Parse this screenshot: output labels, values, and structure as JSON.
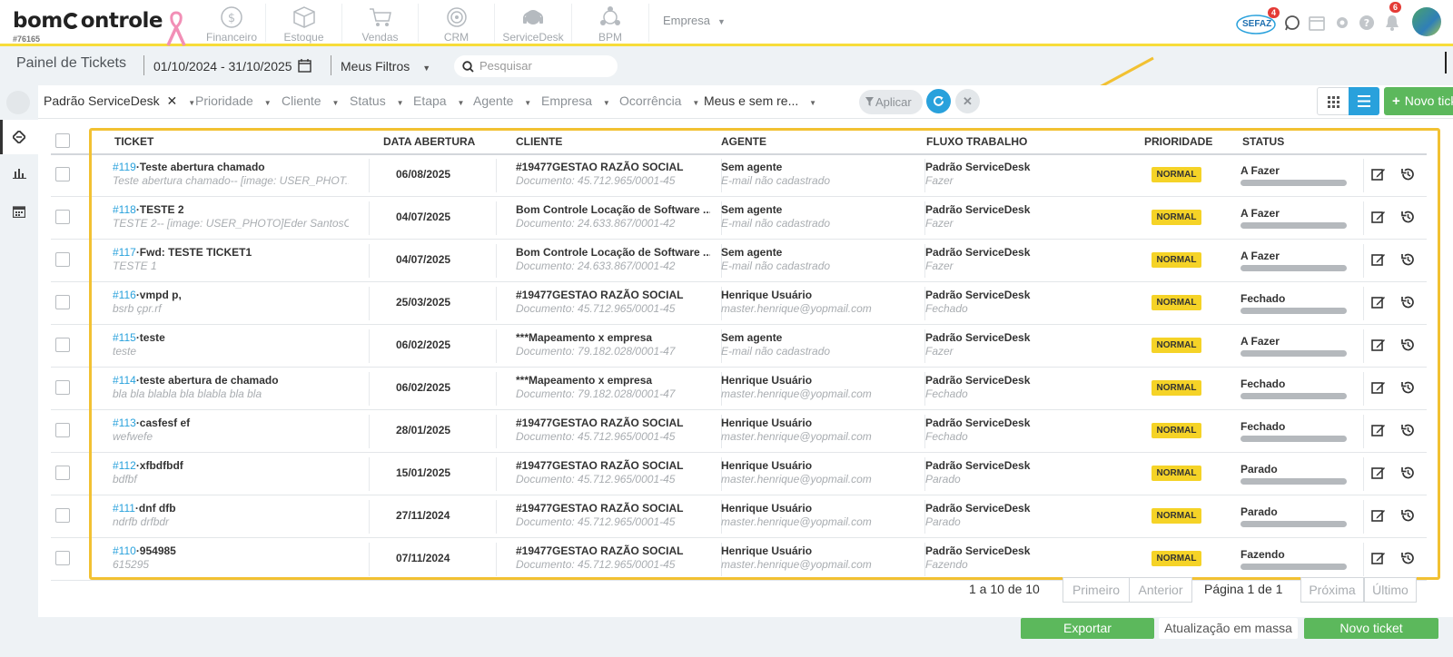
{
  "app": {
    "logo_text": "bomControle",
    "logo_left": "bom",
    "logo_right": "ontrole",
    "account_id": "#76165"
  },
  "modules": [
    {
      "label": "Financeiro",
      "icon": "dollar-coin-icon"
    },
    {
      "label": "Estoque",
      "icon": "box-icon"
    },
    {
      "label": "Vendas",
      "icon": "cart-icon"
    },
    {
      "label": "CRM",
      "icon": "target-icon"
    },
    {
      "label": "ServiceDesk",
      "icon": "headset-icon"
    },
    {
      "label": "BPM",
      "icon": "network-icon"
    }
  ],
  "company_menu": {
    "label": "Empresa"
  },
  "topright": {
    "sefaz_label": "SEFAZ",
    "sefaz_badge": "4",
    "notifications_badge": "6"
  },
  "toolbar": {
    "page_title": "Painel de Tickets",
    "date_range": "01/10/2024 - 31/10/2025",
    "my_filters": "Meus Filtros",
    "search_placeholder": "Pesquisar"
  },
  "filters": {
    "items": [
      "Padrão ServiceDesk",
      "Prioridade",
      "Cliente",
      "Status",
      "Etapa",
      "Agente",
      "Empresa",
      "Ocorrência",
      "Meus e sem re..."
    ],
    "apply_label": "Aplicar",
    "new_ticket_label": "Novo ticket"
  },
  "table": {
    "headers": [
      "TICKET",
      "DATA ABERTURA",
      "CLIENTE",
      "AGENTE",
      "FLUXO TRABALHO",
      "PRIORIDADE",
      "STATUS"
    ],
    "rows": [
      {
        "id": "#119",
        "title": "·Teste abertura chamado",
        "subtitle": "Teste abertura chamado-- [image: USER_PHOT...",
        "date": "06/08/2025",
        "client": "#19477GESTAO RAZÃO SOCIAL",
        "client_doc": "Documento: 45.712.965/0001-45",
        "agent": "Sem agente",
        "agent_email": "E-mail não cadastrado",
        "flow": "Padrão ServiceDesk",
        "flow_stage": "Fazer",
        "priority": "NORMAL",
        "status": "A Fazer",
        "progress": 0
      },
      {
        "id": "#118",
        "title": "·TESTE 2",
        "subtitle": "TESTE 2-- [image: USER_PHOTO]Eder SantosCo...",
        "date": "04/07/2025",
        "client": "Bom Controle Locação de Software ...",
        "client_doc": "Documento: 24.633.867/0001-42",
        "agent": "Sem agente",
        "agent_email": "E-mail não cadastrado",
        "flow": "Padrão ServiceDesk",
        "flow_stage": "Fazer",
        "priority": "NORMAL",
        "status": "A Fazer",
        "progress": 0
      },
      {
        "id": "#117",
        "title": "·Fwd: TESTE TICKET1",
        "subtitle": "TESTE 1",
        "date": "04/07/2025",
        "client": "Bom Controle Locação de Software ...",
        "client_doc": "Documento: 24.633.867/0001-42",
        "agent": "Sem agente",
        "agent_email": "E-mail não cadastrado",
        "flow": "Padrão ServiceDesk",
        "flow_stage": "Fazer",
        "priority": "NORMAL",
        "status": "A Fazer",
        "progress": 0
      },
      {
        "id": "#116",
        "title": "·vmpd p,",
        "subtitle": "bsrb çpr.rf",
        "date": "25/03/2025",
        "client": "#19477GESTAO RAZÃO SOCIAL",
        "client_doc": "Documento: 45.712.965/0001-45",
        "agent": "Henrique Usuário",
        "agent_email": "master.henrique@yopmail.com",
        "flow": "Padrão ServiceDesk",
        "flow_stage": "Fechado",
        "priority": "NORMAL",
        "status": "Fechado",
        "progress": 0
      },
      {
        "id": "#115",
        "title": "·teste",
        "subtitle": "teste",
        "date": "06/02/2025",
        "client": "***Mapeamento x empresa",
        "client_doc": "Documento: 79.182.028/0001-47",
        "agent": "Sem agente",
        "agent_email": "E-mail não cadastrado",
        "flow": "Padrão ServiceDesk",
        "flow_stage": "Fazer",
        "priority": "NORMAL",
        "status": "A Fazer",
        "progress": 0
      },
      {
        "id": "#114",
        "title": "·teste abertura de chamado",
        "subtitle": "bla bla blabla bla blabla bla bla",
        "date": "06/02/2025",
        "client": "***Mapeamento x empresa",
        "client_doc": "Documento: 79.182.028/0001-47",
        "agent": "Henrique Usuário",
        "agent_email": "master.henrique@yopmail.com",
        "flow": "Padrão ServiceDesk",
        "flow_stage": "Fechado",
        "priority": "NORMAL",
        "status": "Fechado",
        "progress": 0
      },
      {
        "id": "#113",
        "title": "·casfesf ef",
        "subtitle": "wefwefe",
        "date": "28/01/2025",
        "client": "#19477GESTAO RAZÃO SOCIAL",
        "client_doc": "Documento: 45.712.965/0001-45",
        "agent": "Henrique Usuário",
        "agent_email": "master.henrique@yopmail.com",
        "flow": "Padrão ServiceDesk",
        "flow_stage": "Fechado",
        "priority": "NORMAL",
        "status": "Fechado",
        "progress": 0
      },
      {
        "id": "#112",
        "title": "·xfbdfbdf",
        "subtitle": "bdfbf",
        "date": "15/01/2025",
        "client": "#19477GESTAO RAZÃO SOCIAL",
        "client_doc": "Documento: 45.712.965/0001-45",
        "agent": "Henrique Usuário",
        "agent_email": "master.henrique@yopmail.com",
        "flow": "Padrão ServiceDesk",
        "flow_stage": "Parado",
        "priority": "NORMAL",
        "status": "Parado",
        "progress": 0
      },
      {
        "id": "#111",
        "title": "·dnf dfb",
        "subtitle": "ndrfb drfbdr",
        "date": "27/11/2024",
        "client": "#19477GESTAO RAZÃO SOCIAL",
        "client_doc": "Documento: 45.712.965/0001-45",
        "agent": "Henrique Usuário",
        "agent_email": "master.henrique@yopmail.com",
        "flow": "Padrão ServiceDesk",
        "flow_stage": "Parado",
        "priority": "NORMAL",
        "status": "Parado",
        "progress": 0
      },
      {
        "id": "#110",
        "title": "·954985",
        "subtitle": "615295",
        "date": "07/11/2024",
        "client": "#19477GESTAO RAZÃO SOCIAL",
        "client_doc": "Documento: 45.712.965/0001-45",
        "agent": "Henrique Usuário",
        "agent_email": "master.henrique@yopmail.com",
        "flow": "Padrão ServiceDesk",
        "flow_stage": "Fazendo",
        "priority": "NORMAL",
        "status": "Fazendo",
        "progress": 0
      }
    ]
  },
  "pagination": {
    "range_info": "1 a 10 de 10",
    "first": "Primeiro",
    "prev": "Anterior",
    "page_prefix": "Página",
    "page_current": "1",
    "page_of": "de 1",
    "next": "Próxima",
    "last": "Último"
  },
  "footer": {
    "export_label": "Exportar",
    "bulk_update_label": "Atualização em massa",
    "new_ticket_label": "Novo ticket"
  },
  "colors": {
    "accent": "#29a1dc",
    "highlight": "#f2c132",
    "priority_badge": "#f5d327",
    "success": "#5cb85c",
    "notify": "#e43b36"
  }
}
